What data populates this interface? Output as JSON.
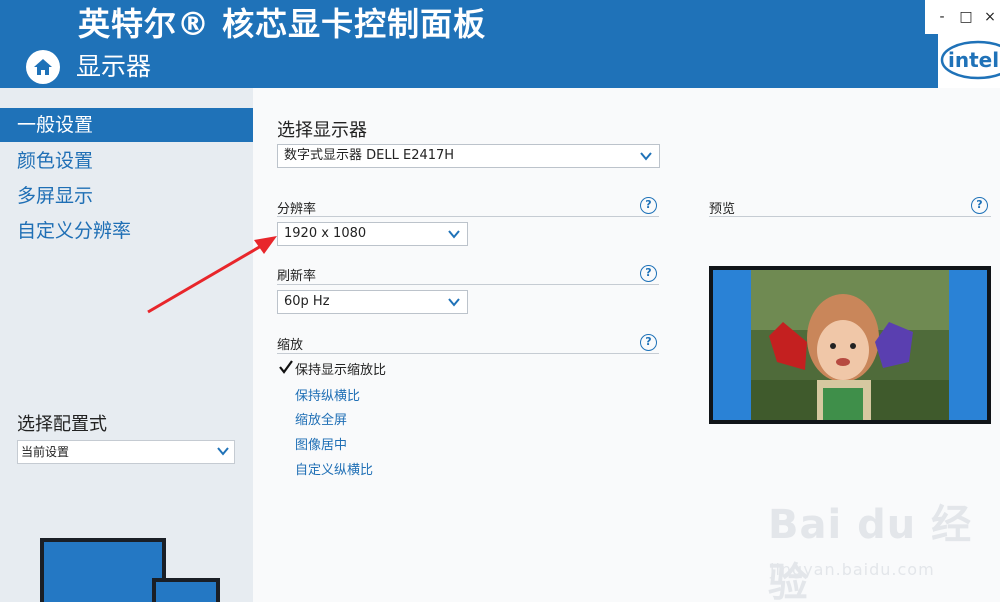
{
  "header": {
    "app_title": "英特尔® 核芯显卡控制面板",
    "section_title": "显示器",
    "window_controls": [
      "-",
      "□",
      "×"
    ],
    "brand_logo": "intel"
  },
  "sidebar": {
    "items": [
      {
        "label": "一般设置",
        "active": true
      },
      {
        "label": "颜色设置",
        "active": false
      },
      {
        "label": "多屏显示",
        "active": false
      },
      {
        "label": "自定义分辨率",
        "active": false
      }
    ],
    "config_label": "选择配置式",
    "config_value": "当前设置"
  },
  "main": {
    "select_display_title": "选择显示器",
    "display_value": "数字式显示器 DELL E2417H",
    "resolution_label": "分辨率",
    "resolution_value": "1920 x 1080",
    "refresh_label": "刷新率",
    "refresh_value": "60p Hz",
    "scaling_label": "缩放",
    "scaling_checked": "保持显示缩放比",
    "scaling_options": [
      "保持纵横比",
      "缩放全屏",
      "图像居中",
      "自定义纵横比"
    ],
    "preview_label": "预览",
    "help_symbol": "?"
  },
  "watermark": {
    "main": "Bai du 经验",
    "sub": "jingyan.baidu.com"
  },
  "colors": {
    "header_blue": "#1f72b8",
    "annotation_red": "#e8262b"
  },
  "icons": {
    "home": "home-icon",
    "dropdown": "chevron-down-icon",
    "help": "help-icon",
    "check": "check-icon"
  }
}
